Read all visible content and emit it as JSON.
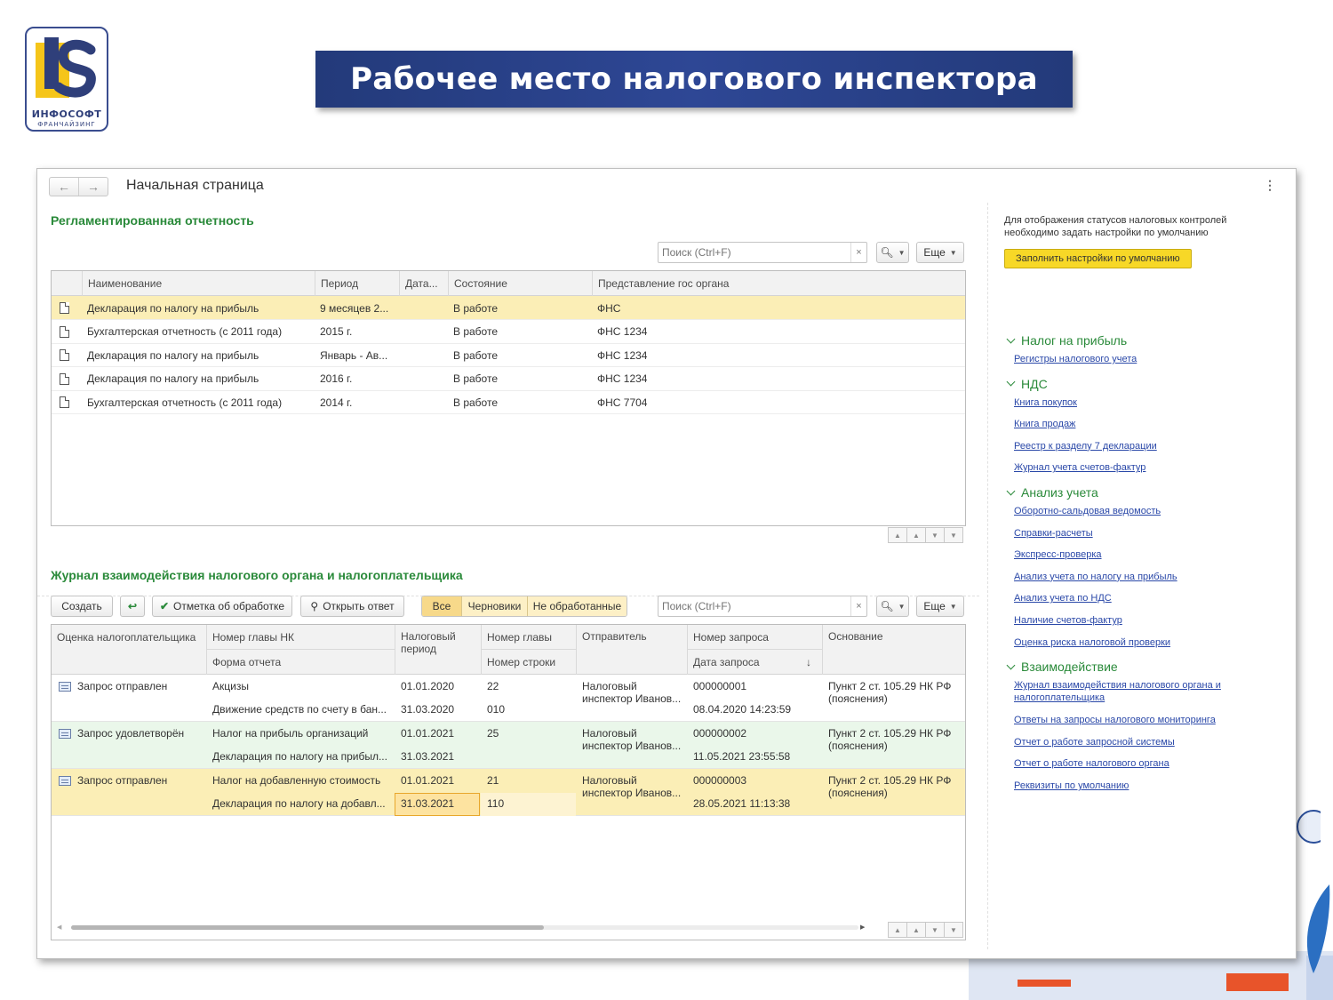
{
  "slide": {
    "title": "Рабочее место налогового инспектора",
    "logo": {
      "brand": "ИНФОСОФТ",
      "subtitle": "ФРАНЧАЙЗИНГ",
      "colors": [
        "#f5c51a",
        "#2f3f7a"
      ]
    }
  },
  "window": {
    "title": "Начальная страница",
    "nav": {
      "back_icon": "arrow-left",
      "forward_icon": "arrow-right"
    },
    "menu_icon": "kebab-menu"
  },
  "reports": {
    "section_title": "Регламентированная отчетность",
    "search_placeholder": "Поиск (Ctrl+F)",
    "more_label": "Еще",
    "columns": [
      "Наименование",
      "Период",
      "Дата...",
      "Состояние",
      "Представление гос органа"
    ],
    "rows": [
      {
        "name": "Декларация по налогу на прибыль",
        "period": "9 месяцев 2...",
        "date": "",
        "state": "В работе",
        "agency": "ФНС",
        "selected": true
      },
      {
        "name": "Бухгалтерская отчетность (с 2011 года)",
        "period": "2015 г.",
        "date": "",
        "state": "В работе",
        "agency": "ФНС 1234",
        "selected": false
      },
      {
        "name": "Декларация по налогу на прибыль",
        "period": "Январь - Ав...",
        "date": "",
        "state": "В работе",
        "agency": "ФНС 1234",
        "selected": false
      },
      {
        "name": "Декларация по налогу на прибыль",
        "period": "2016 г.",
        "date": "",
        "state": "В работе",
        "agency": "ФНС 1234",
        "selected": false
      },
      {
        "name": "Бухгалтерская отчетность (с 2011 года)",
        "period": "2014 г.",
        "date": "",
        "state": "В работе",
        "agency": "ФНС 7704",
        "selected": false
      }
    ]
  },
  "journal": {
    "section_title": "Журнал взаимодействия налогового органа и налогоплательщика",
    "toolbar": {
      "create": "Создать",
      "mark_processed": "Отметка об обработке",
      "open_reply": "Открыть ответ",
      "filters": [
        "Все",
        "Черновики",
        "Не обработанные"
      ],
      "active_filter": "Все",
      "search_placeholder": "Поиск (Ctrl+F)",
      "more_label": "Еще"
    },
    "columns": {
      "assessment": "Оценка налогоплательщика",
      "chapter_nk": "Номер главы НК",
      "report_form": "Форма отчета",
      "tax_period": "Налоговый период",
      "chapter_no": "Номер главы",
      "line_no": "Номер строки",
      "sender": "Отправитель",
      "request_no": "Номер запроса",
      "request_date": "Дата запроса",
      "basis": "Основание"
    },
    "rows": [
      {
        "status": "Запрос отправлен",
        "chapter_nk": "Акцизы",
        "form": "Движение средств по счету в бан...",
        "period_start": "01.01.2020",
        "period_end": "31.03.2020",
        "chapter_no": "22",
        "line_no": "010",
        "sender": "Налоговый инспектор Иванов...",
        "request_no": "000000001",
        "request_date": "08.04.2020 14:23:59",
        "basis": "Пункт 2 ст. 105.29 НК РФ (пояснения)",
        "style": "plain"
      },
      {
        "status": "Запрос удовлетворён",
        "chapter_nk": "Налог на прибыль организаций",
        "form": "Декларация по налогу на прибыл...",
        "period_start": "01.01.2021",
        "period_end": "31.03.2021",
        "chapter_no": "25",
        "line_no": "",
        "sender": "Налоговый инспектор Иванов...",
        "request_no": "000000002",
        "request_date": "11.05.2021 23:55:58",
        "basis": "Пункт 2 ст. 105.29 НК РФ (пояснения)",
        "style": "green"
      },
      {
        "status": "Запрос отправлен",
        "chapter_nk": "Налог на добавленную стоимость",
        "form": "Декларация по налогу на добавл...",
        "period_start": "01.01.2021",
        "period_end": "31.03.2021",
        "chapter_no": "21",
        "line_no": "110",
        "sender": "Налоговый инспектор Иванов...",
        "request_no": "000000003",
        "request_date": "28.05.2021 11:13:38",
        "basis": "Пункт 2 ст. 105.29 НК РФ (пояснения)",
        "style": "selected"
      }
    ]
  },
  "side": {
    "note": "Для отображения статусов налоговых контролей необходимо задать настройки по умолчанию",
    "fill_button": "Заполнить настройки по умолчанию",
    "groups": [
      {
        "title": "Налог на прибыль",
        "links": [
          "Регистры налогового учета"
        ]
      },
      {
        "title": "НДС",
        "links": [
          "Книга покупок",
          "Книга продаж",
          "Реестр к разделу 7 декларации",
          "Журнал учета счетов-фактур"
        ]
      },
      {
        "title": "Анализ учета",
        "links": [
          "Оборотно-сальдовая ведомость",
          "Справки-расчеты",
          "Экспресс-проверка",
          "Анализ учета по налогу на прибыль",
          "Анализ учета по НДС",
          "Наличие счетов-фактур",
          "Оценка риска налоговой проверки"
        ]
      },
      {
        "title": "Взаимодействие",
        "links": [
          "Журнал взаимодействия налогового органа и налогоплательщика",
          "Ответы на запросы налогового мониторинга",
          "Отчет о работе запросной системы",
          "Отчет о работе налогового органа",
          "Реквизиты по умолчанию"
        ]
      }
    ]
  },
  "colors": {
    "accent_green": "#2a8a3a",
    "link_blue": "#2a48a8",
    "selection": "#fbeeb6",
    "banner": "#2e4795"
  }
}
